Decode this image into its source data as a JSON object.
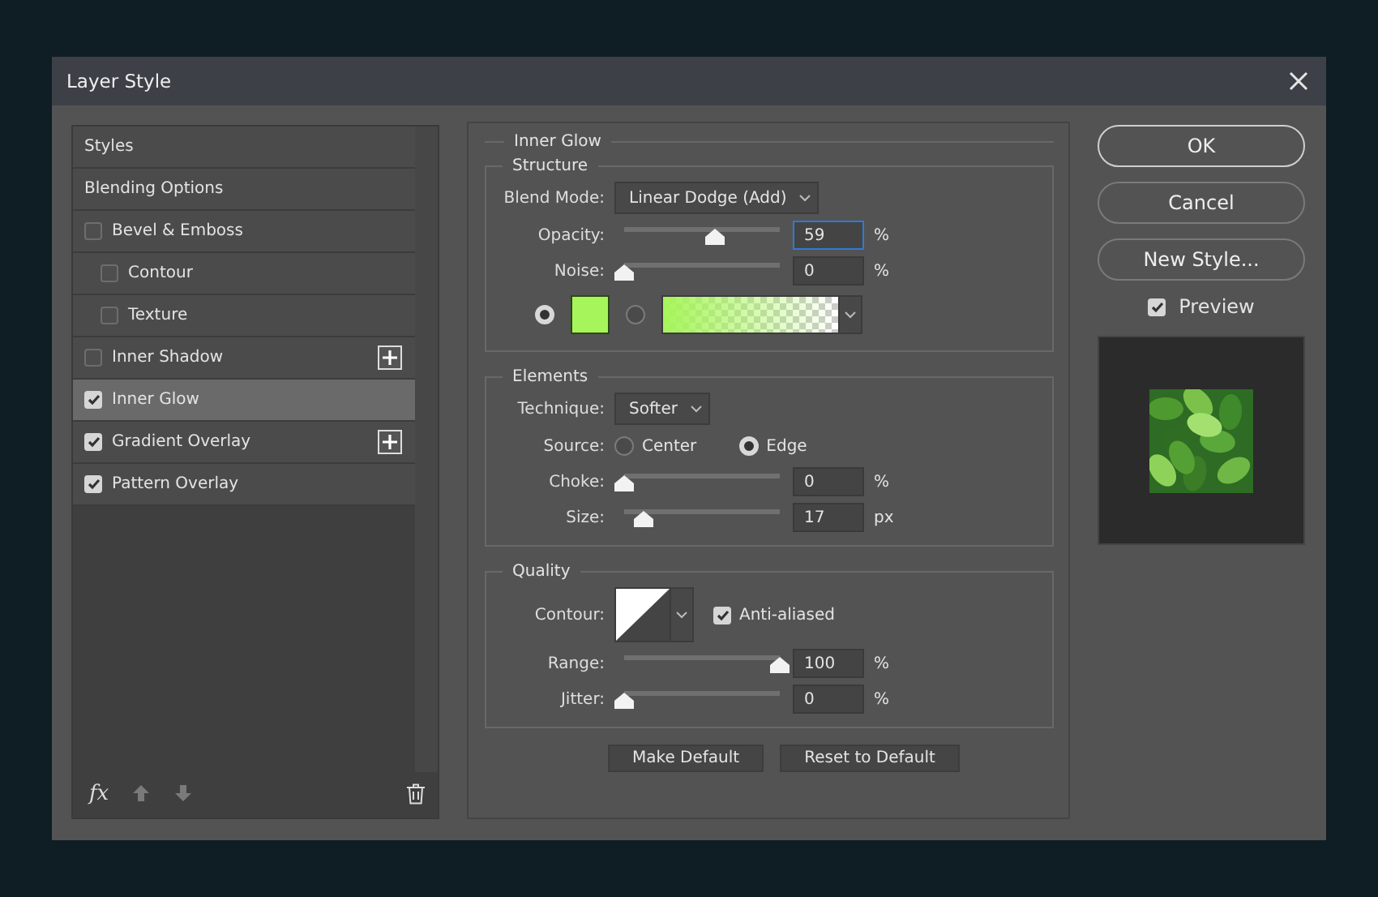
{
  "window": {
    "title": "Layer Style"
  },
  "styles_list": [
    {
      "kind": "header",
      "label": "Styles",
      "selected": false
    },
    {
      "kind": "header",
      "label": "Blending Options",
      "selected": false
    },
    {
      "kind": "effect",
      "label": "Bevel & Emboss",
      "checked": false,
      "selected": false,
      "addable": false,
      "children": [
        {
          "kind": "effect",
          "label": "Contour",
          "checked": false,
          "selected": false,
          "addable": false
        },
        {
          "kind": "effect",
          "label": "Texture",
          "checked": false,
          "selected": false,
          "addable": false
        }
      ]
    },
    {
      "kind": "effect",
      "label": "Inner Shadow",
      "checked": false,
      "selected": false,
      "addable": true
    },
    {
      "kind": "effect",
      "label": "Inner Glow",
      "checked": true,
      "selected": true,
      "addable": false
    },
    {
      "kind": "effect",
      "label": "Gradient Overlay",
      "checked": true,
      "selected": false,
      "addable": true
    },
    {
      "kind": "effect",
      "label": "Pattern Overlay",
      "checked": true,
      "selected": false,
      "addable": false
    }
  ],
  "list_toolbar": {
    "fx": "fx"
  },
  "panel": {
    "title": "Inner Glow",
    "structure": {
      "title": "Structure",
      "blend_mode": {
        "label": "Blend Mode:",
        "value": "Linear Dodge (Add)"
      },
      "sliders": [
        {
          "label": "Opacity:",
          "level": 0.58,
          "value": "59",
          "unit": "%",
          "focused": true
        },
        {
          "label": "Noise:",
          "level": 0,
          "value": "0",
          "unit": "%",
          "focused": false
        }
      ],
      "fill_options": [
        {
          "kind": "swatch",
          "selected": true,
          "color": "#a6f55a"
        },
        {
          "kind": "gradient",
          "selected": false,
          "color": "#a6f55a"
        }
      ]
    },
    "elements": {
      "title": "Elements",
      "technique": {
        "label": "Technique:",
        "value": "Softer"
      },
      "source": {
        "label": "Source:",
        "options": [
          {
            "label": "Center",
            "selected": false
          },
          {
            "label": "Edge",
            "selected": true
          }
        ]
      },
      "sliders": [
        {
          "label": "Choke:",
          "level": 0,
          "value": "0",
          "unit": "%",
          "focused": false
        },
        {
          "label": "Size:",
          "level": 0.12,
          "value": "17",
          "unit": "px",
          "focused": false
        }
      ]
    },
    "quality": {
      "title": "Quality",
      "contour": {
        "label": "Contour:"
      },
      "anti_aliased": {
        "label": "Anti-aliased",
        "checked": true
      },
      "sliders": [
        {
          "label": "Range:",
          "level": 1,
          "value": "100",
          "unit": "%",
          "focused": false
        },
        {
          "label": "Jitter:",
          "level": 0,
          "value": "0",
          "unit": "%",
          "focused": false
        }
      ]
    },
    "buttons": [
      "Make Default",
      "Reset to Default"
    ]
  },
  "actions": [
    {
      "label": "OK",
      "primary": true
    },
    {
      "label": "Cancel",
      "primary": false
    },
    {
      "label": "New Style...",
      "primary": false
    }
  ],
  "preview": {
    "label": "Preview",
    "checked": true
  }
}
